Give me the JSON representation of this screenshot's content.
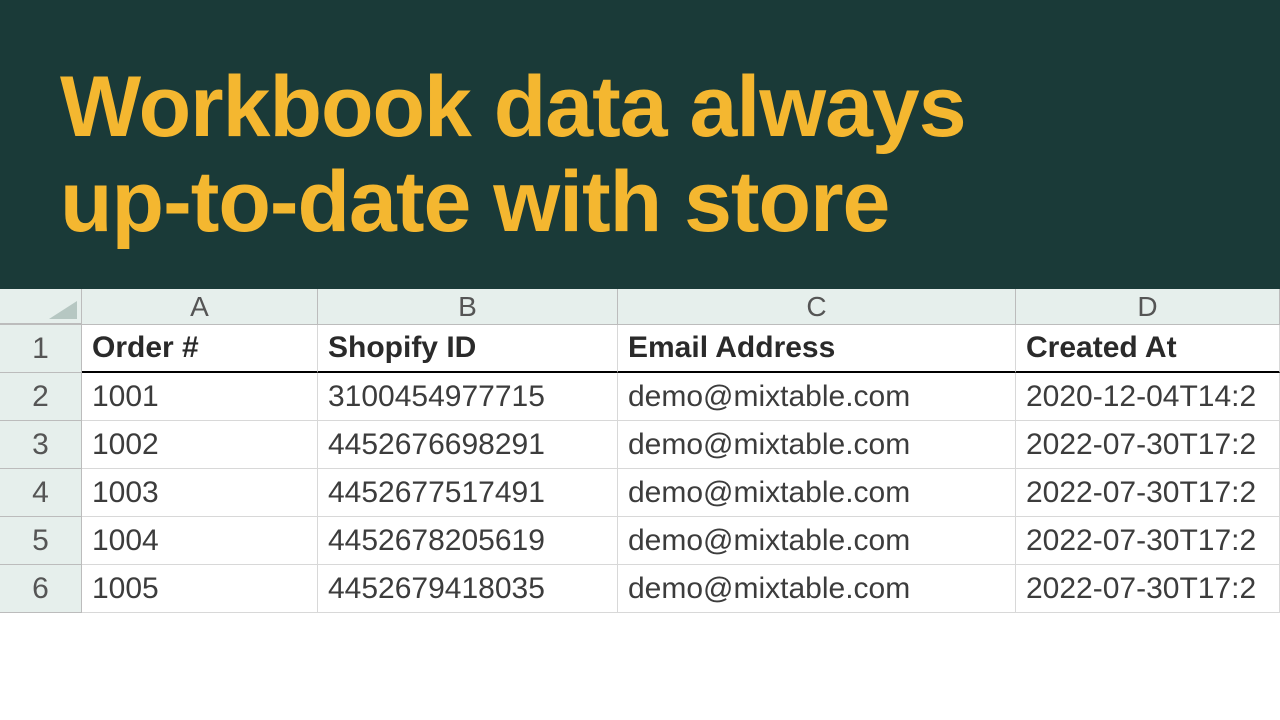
{
  "hero": {
    "title_line1": "Workbook data always",
    "title_line2": "up-to-date with store"
  },
  "sheet": {
    "column_letters": [
      "A",
      "B",
      "C",
      "D"
    ],
    "row_numbers": [
      "1",
      "2",
      "3",
      "4",
      "5",
      "6"
    ],
    "headers": {
      "order_number": "Order #",
      "shopify_id": "Shopify ID",
      "email": "Email Address",
      "created_at": "Created At"
    },
    "rows": [
      {
        "order_number": "1001",
        "shopify_id": "3100454977715",
        "email": "demo@mixtable.com",
        "created_at": "2020-12-04T14:2"
      },
      {
        "order_number": "1002",
        "shopify_id": "4452676698291",
        "email": "demo@mixtable.com",
        "created_at": "2022-07-30T17:2"
      },
      {
        "order_number": "1003",
        "shopify_id": "4452677517491",
        "email": "demo@mixtable.com",
        "created_at": "2022-07-30T17:2"
      },
      {
        "order_number": "1004",
        "shopify_id": "4452678205619",
        "email": "demo@mixtable.com",
        "created_at": "2022-07-30T17:2"
      },
      {
        "order_number": "1005",
        "shopify_id": "4452679418035",
        "email": "demo@mixtable.com",
        "created_at": "2022-07-30T17:2"
      }
    ]
  }
}
